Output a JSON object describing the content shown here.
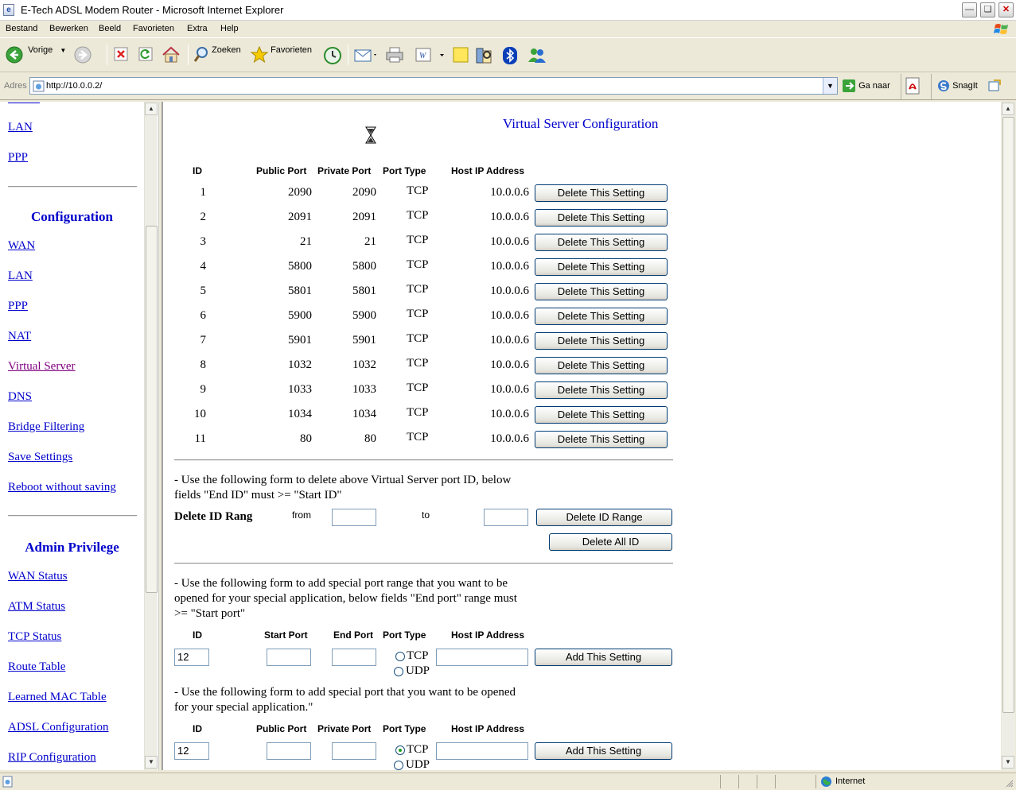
{
  "window": {
    "title": "E-Tech ADSL Modem Router - Microsoft Internet Explorer"
  },
  "menu": [
    "Bestand",
    "Bewerken",
    "Beeld",
    "Favorieten",
    "Extra",
    "Help"
  ],
  "toolbar": {
    "back": "Vorige",
    "search": "Zoeken",
    "favorites": "Favorieten"
  },
  "address": {
    "label": "Adres",
    "url": "http://10.0.0.2/",
    "go": "Ga naar",
    "snagit": "SnagIt"
  },
  "sidebar": {
    "top_links": [
      "LAN",
      "PPP"
    ],
    "config_heading": "Configuration",
    "config_links": [
      "WAN",
      "LAN",
      "PPP",
      "NAT",
      "Virtual Server",
      "DNS",
      "Bridge Filtering",
      "Save Settings",
      "Reboot without saving"
    ],
    "admin_heading": "Admin Privilege",
    "admin_links": [
      "WAN Status",
      "ATM Status",
      "TCP Status",
      "Route Table",
      "Learned MAC Table",
      "ADSL Configuration",
      "RIP Configuration"
    ]
  },
  "main": {
    "title": "Virtual Server Configuration",
    "table_headers": {
      "id": "ID",
      "public_port": "Public Port",
      "private_port": "Private Port",
      "port_type": "Port Type",
      "host_ip": "Host IP Address"
    },
    "rows": [
      {
        "id": "1",
        "public": "2090",
        "private": "2090",
        "type": "TCP",
        "ip": "10.0.0.6"
      },
      {
        "id": "2",
        "public": "2091",
        "private": "2091",
        "type": "TCP",
        "ip": "10.0.0.6"
      },
      {
        "id": "3",
        "public": "21",
        "private": "21",
        "type": "TCP",
        "ip": "10.0.0.6"
      },
      {
        "id": "4",
        "public": "5800",
        "private": "5800",
        "type": "TCP",
        "ip": "10.0.0.6"
      },
      {
        "id": "5",
        "public": "5801",
        "private": "5801",
        "type": "TCP",
        "ip": "10.0.0.6"
      },
      {
        "id": "6",
        "public": "5900",
        "private": "5900",
        "type": "TCP",
        "ip": "10.0.0.6"
      },
      {
        "id": "7",
        "public": "5901",
        "private": "5901",
        "type": "TCP",
        "ip": "10.0.0.6"
      },
      {
        "id": "8",
        "public": "1032",
        "private": "1032",
        "type": "TCP",
        "ip": "10.0.0.6"
      },
      {
        "id": "9",
        "public": "1033",
        "private": "1033",
        "type": "TCP",
        "ip": "10.0.0.6"
      },
      {
        "id": "10",
        "public": "1034",
        "private": "1034",
        "type": "TCP",
        "ip": "10.0.0.6"
      },
      {
        "id": "11",
        "public": "80",
        "private": "80",
        "type": "TCP",
        "ip": "10.0.0.6"
      }
    ],
    "delete_button": "Delete This Setting",
    "delete_range": {
      "note_line1": "- Use the following form to delete above Virtual Server port ID, below",
      "note_line2": "fields \"End ID\" must >= \"Start ID\"",
      "label": "Delete ID Rang",
      "from": "from",
      "to": "to",
      "from_value": "",
      "to_value": "",
      "range_button": "Delete ID  Range",
      "all_button": "Delete All ID"
    },
    "add_range": {
      "note_line1": "- Use the following form to add special port range that you want to be",
      "note_line2": "opened for your special application, below fields \"End port\" range must",
      "note_line3": ">= \"Start port\"",
      "headers": {
        "id": "ID",
        "start_port": "Start Port",
        "end_port": "End Port",
        "port_type": "Port Type",
        "host_ip": "Host IP Address"
      },
      "id_value": "12",
      "tcp": "TCP",
      "udp": "UDP",
      "button": "Add This Setting"
    },
    "add_single": {
      "note_line1": "- Use the following form to add special port that you want to be opened",
      "note_line2": "for your special application.\"",
      "headers": {
        "id": "ID",
        "public_port": "Public Port",
        "private_port": "Private Port",
        "port_type": "Port Type",
        "host_ip": "Host IP Address"
      },
      "id_value": "12",
      "tcp": "TCP",
      "udp": "UDP",
      "button": "Add This Setting"
    }
  },
  "status": {
    "zone": "Internet"
  }
}
